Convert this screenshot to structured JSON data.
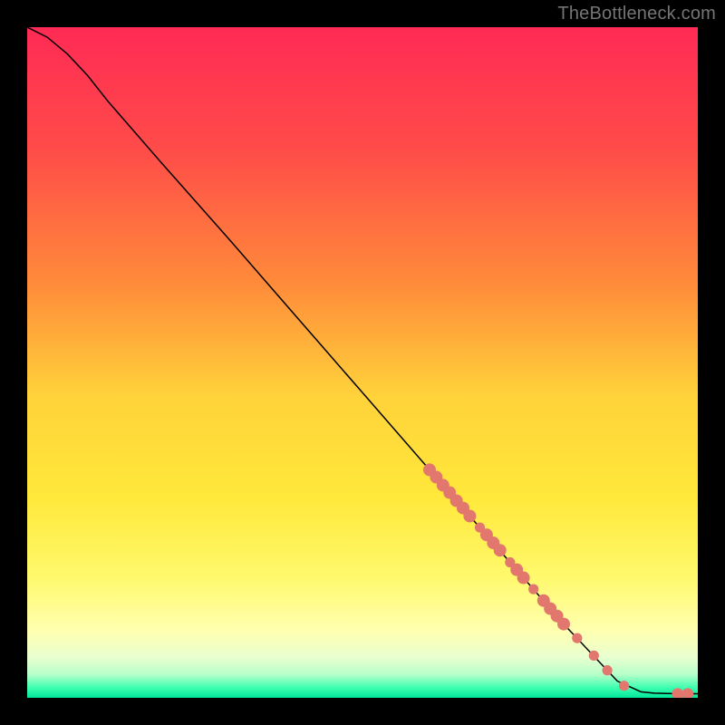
{
  "attribution": "TheBottleneck.com",
  "chart_data": {
    "type": "line",
    "title": "",
    "xlabel": "",
    "ylabel": "",
    "xlim": [
      0,
      100
    ],
    "ylim": [
      0,
      100
    ],
    "gradient_stops": [
      {
        "offset": 0.0,
        "color": "#ff2a55"
      },
      {
        "offset": 0.18,
        "color": "#ff4b49"
      },
      {
        "offset": 0.38,
        "color": "#ff8a3a"
      },
      {
        "offset": 0.55,
        "color": "#ffd23a"
      },
      {
        "offset": 0.7,
        "color": "#ffe83a"
      },
      {
        "offset": 0.82,
        "color": "#fff96c"
      },
      {
        "offset": 0.9,
        "color": "#ffffb0"
      },
      {
        "offset": 0.94,
        "color": "#e8ffd0"
      },
      {
        "offset": 0.965,
        "color": "#b7ffc9"
      },
      {
        "offset": 0.985,
        "color": "#3dffb0"
      },
      {
        "offset": 1.0,
        "color": "#00e69a"
      }
    ],
    "curve": [
      {
        "x": 0.0,
        "y": 100.0
      },
      {
        "x": 3.0,
        "y": 98.5
      },
      {
        "x": 6.0,
        "y": 96.0
      },
      {
        "x": 9.0,
        "y": 92.8
      },
      {
        "x": 12.0,
        "y": 89.0
      },
      {
        "x": 20.0,
        "y": 79.8
      },
      {
        "x": 30.0,
        "y": 68.5
      },
      {
        "x": 40.0,
        "y": 57.0
      },
      {
        "x": 50.0,
        "y": 45.5
      },
      {
        "x": 60.0,
        "y": 34.0
      },
      {
        "x": 70.0,
        "y": 22.5
      },
      {
        "x": 80.0,
        "y": 11.0
      },
      {
        "x": 88.0,
        "y": 2.5
      },
      {
        "x": 91.5,
        "y": 0.9
      },
      {
        "x": 93.5,
        "y": 0.7
      },
      {
        "x": 97.0,
        "y": 0.6
      },
      {
        "x": 100.0,
        "y": 0.6
      }
    ],
    "markers": [
      {
        "x": 60.0,
        "y": 34.0,
        "r": 1.0
      },
      {
        "x": 61.0,
        "y": 32.9,
        "r": 1.0
      },
      {
        "x": 62.0,
        "y": 31.7,
        "r": 1.0
      },
      {
        "x": 63.0,
        "y": 30.6,
        "r": 1.0
      },
      {
        "x": 64.0,
        "y": 29.4,
        "r": 1.0
      },
      {
        "x": 65.0,
        "y": 28.3,
        "r": 1.0
      },
      {
        "x": 66.0,
        "y": 27.1,
        "r": 1.0
      },
      {
        "x": 67.5,
        "y": 25.4,
        "r": 0.8
      },
      {
        "x": 68.5,
        "y": 24.3,
        "r": 1.0
      },
      {
        "x": 69.5,
        "y": 23.1,
        "r": 1.0
      },
      {
        "x": 70.5,
        "y": 22.0,
        "r": 1.0
      },
      {
        "x": 72.0,
        "y": 20.2,
        "r": 0.8
      },
      {
        "x": 73.0,
        "y": 19.1,
        "r": 1.0
      },
      {
        "x": 74.0,
        "y": 17.9,
        "r": 1.0
      },
      {
        "x": 75.5,
        "y": 16.2,
        "r": 0.8
      },
      {
        "x": 77.0,
        "y": 14.5,
        "r": 1.0
      },
      {
        "x": 78.0,
        "y": 13.3,
        "r": 1.0
      },
      {
        "x": 79.0,
        "y": 12.2,
        "r": 1.0
      },
      {
        "x": 80.0,
        "y": 11.0,
        "r": 1.0
      },
      {
        "x": 82.0,
        "y": 8.9,
        "r": 0.8
      },
      {
        "x": 84.5,
        "y": 6.3,
        "r": 0.8
      },
      {
        "x": 86.5,
        "y": 4.1,
        "r": 0.8
      },
      {
        "x": 89.0,
        "y": 1.8,
        "r": 0.8
      },
      {
        "x": 97.0,
        "y": 0.6,
        "r": 0.9
      },
      {
        "x": 98.5,
        "y": 0.6,
        "r": 0.9
      }
    ],
    "marker_color": "#e2776e",
    "curve_color": "#000000"
  }
}
